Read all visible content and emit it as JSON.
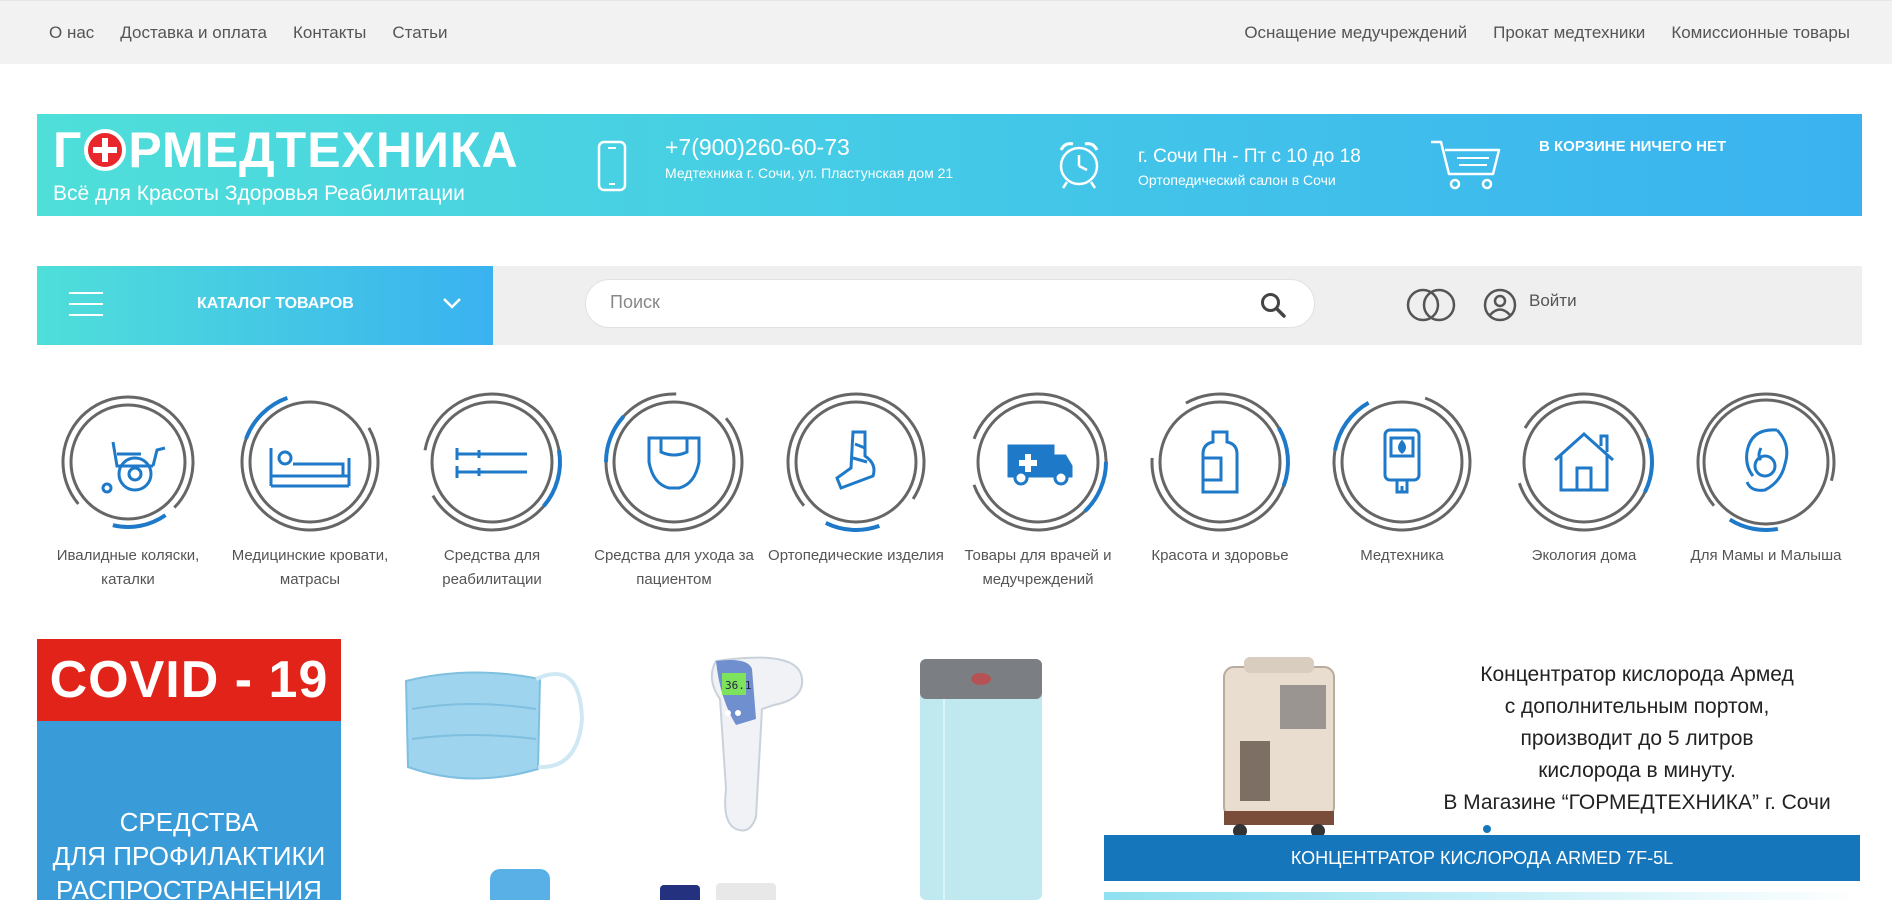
{
  "topnav": {
    "left": [
      "О нас",
      "Доставка и оплата",
      "Контакты",
      "Статьи"
    ],
    "right": [
      "Оснащение медучреждений",
      "Прокат медтехники",
      "Комиссионные товары"
    ]
  },
  "header": {
    "logo_name_part1": "Г",
    "logo_name_part2": "РМЕДТЕХНИКА",
    "logo_tagline": "Всё для Красоты Здоровья Реабилитации",
    "phone": "+7(900)260-60-73",
    "address": "Медтехника г. Сочи, ул. Пластунская дом 21",
    "hours": "г. Сочи Пн - Пт с 10 до 18",
    "salon": "Ортопедический салон в Сочи",
    "cart_status": "В КОРЗИНЕ НИЧЕГО НЕТ"
  },
  "navbar": {
    "catalog_label": "КАТАЛОГ ТОВАРОВ",
    "search_placeholder": "Поиск",
    "login_label": "Войти"
  },
  "categories": [
    {
      "label": "Ивалидные коляски, каталки",
      "icon": "wheelchair-icon"
    },
    {
      "label": "Медицинские кровати, матрасы",
      "icon": "bed-icon"
    },
    {
      "label": "Средства для реабилитации",
      "icon": "crutches-icon"
    },
    {
      "label": "Средства для ухода за пациентом",
      "icon": "diaper-icon"
    },
    {
      "label": "Ортопедические изделия",
      "icon": "ankle-brace-icon"
    },
    {
      "label": "Товары для врачей и медучреждений",
      "icon": "ambulance-icon"
    },
    {
      "label": "Красота и здоровье",
      "icon": "bottle-icon"
    },
    {
      "label": "Медтехника",
      "icon": "glucometer-icon"
    },
    {
      "label": "Экология дома",
      "icon": "house-icon"
    },
    {
      "label": "Для Мамы и Малыша",
      "icon": "mother-baby-icon"
    }
  ],
  "promo": {
    "covid_title": "COVID - 19",
    "covid_text_1": "СРЕДСТВА",
    "covid_text_2": "ДЛЯ ПРОФИЛАКТИКИ",
    "covid_text_3": "РАСПРОСТРАНЕНИЯ",
    "thermometer_display": "36.1"
  },
  "slider": {
    "lines": [
      "Концентратор кислорода Армед",
      "с дополнительным портом,",
      "производит до 5 литров",
      "кислорода в минуту.",
      "В Магазине “ГОРМЕДТЕХНИКА” г. Сочи"
    ],
    "caption": "КОНЦЕНТРАТОР КИСЛОРОДА  ARMED  7F-5L"
  },
  "colors": {
    "accent_gradient_start": "#4fdfd9",
    "accent_gradient_end": "#3ab2f0",
    "icon_blue": "#1e7ac8",
    "covid_red": "#e2231a",
    "caption_blue": "#1576bb"
  }
}
